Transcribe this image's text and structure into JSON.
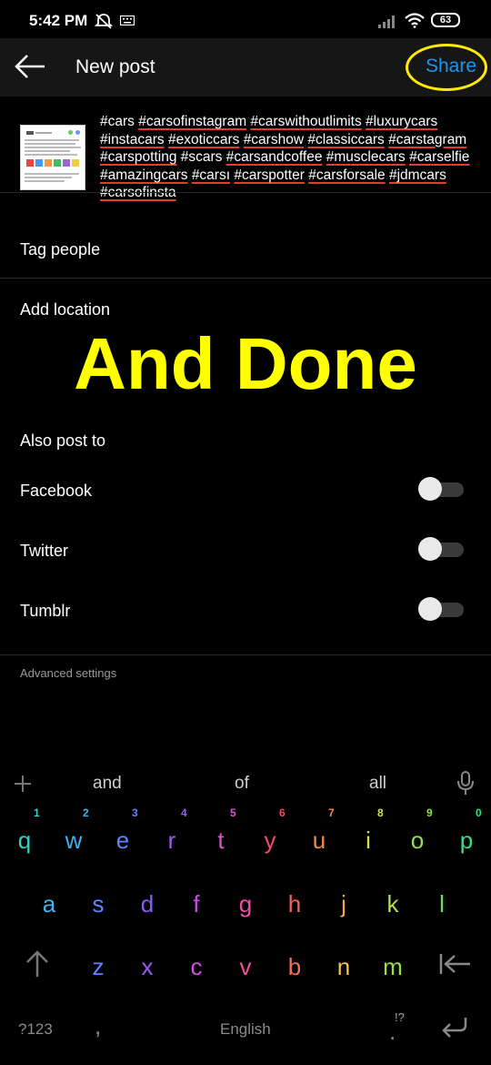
{
  "status_bar": {
    "time": "5:42 PM",
    "battery": "63"
  },
  "header": {
    "title": "New post",
    "share_label": "Share"
  },
  "caption": {
    "tags": [
      {
        "text": "#cars",
        "u": false
      },
      {
        "text": "#carsofinstagram",
        "u": true
      },
      {
        "text": "#carswithoutlimits",
        "u": true
      },
      {
        "text": "#luxurycars",
        "u": true
      },
      {
        "text": "#instacars",
        "u": true
      },
      {
        "text": "#exoticcars",
        "u": true
      },
      {
        "text": "#carshow",
        "u": true
      },
      {
        "text": "#classiccars",
        "u": true
      },
      {
        "text": "#carstagram",
        "u": true
      },
      {
        "text": "#carspotting",
        "u": true
      },
      {
        "text": "#scars",
        "u": false
      },
      {
        "text": "#carsandcoffee",
        "u": true
      },
      {
        "text": "#musclecars",
        "u": true
      },
      {
        "text": "#carselfie",
        "u": true
      },
      {
        "text": "#amazingcars",
        "u": true
      },
      {
        "text": "#carsı",
        "u": true
      },
      {
        "text": "#carspotter",
        "u": true
      },
      {
        "text": "#carsforsale",
        "u": true
      },
      {
        "text": "#jdmcars",
        "u": true
      },
      {
        "text": "#carsofinsta",
        "u": true
      }
    ]
  },
  "rows": {
    "tag_people": "Tag people",
    "add_location": "Add location",
    "also_post_to": "Also post to",
    "facebook": "Facebook",
    "twitter": "Twitter",
    "tumblr": "Tumblr",
    "advanced": "Advanced settings"
  },
  "overlay_text": "And Done",
  "keyboard": {
    "suggestions": [
      "and",
      "of",
      "all"
    ],
    "row1": [
      {
        "k": "q",
        "n": "1",
        "c": "#2ed3c8"
      },
      {
        "k": "w",
        "n": "2",
        "c": "#3fb3f0"
      },
      {
        "k": "e",
        "n": "3",
        "c": "#5c85ff"
      },
      {
        "k": "r",
        "n": "4",
        "c": "#9a5cf5"
      },
      {
        "k": "t",
        "n": "5",
        "c": "#e24fd0"
      },
      {
        "k": "y",
        "n": "6",
        "c": "#f24b6f"
      },
      {
        "k": "u",
        "n": "7",
        "c": "#f5894a"
      },
      {
        "k": "i",
        "n": "8",
        "c": "#d8e043"
      },
      {
        "k": "o",
        "n": "9",
        "c": "#8fe04a"
      },
      {
        "k": "p",
        "n": "0",
        "c": "#35e088"
      }
    ],
    "row2": [
      {
        "k": "a",
        "c": "#3fb3f0"
      },
      {
        "k": "s",
        "c": "#5c85ff"
      },
      {
        "k": "d",
        "c": "#8a5cf5"
      },
      {
        "k": "f",
        "c": "#c24fe0"
      },
      {
        "k": "g",
        "c": "#f04fa8"
      },
      {
        "k": "h",
        "c": "#f2605a"
      },
      {
        "k": "j",
        "c": "#f5a84a"
      },
      {
        "k": "k",
        "c": "#b8e043"
      },
      {
        "k": "l",
        "c": "#5fe06a"
      }
    ],
    "row3": [
      {
        "k": "z",
        "c": "#5c85ff"
      },
      {
        "k": "x",
        "c": "#9a5cf5"
      },
      {
        "k": "c",
        "c": "#d04fe0"
      },
      {
        "k": "v",
        "c": "#f04f9a"
      },
      {
        "k": "b",
        "c": "#f2705a"
      },
      {
        "k": "n",
        "c": "#f5c04a"
      },
      {
        "k": "m",
        "c": "#9be04a"
      }
    ],
    "bottom": {
      "sym": "?123",
      "comma": ",",
      "space": "English",
      "period": ".",
      "period_hint": "!?"
    }
  }
}
